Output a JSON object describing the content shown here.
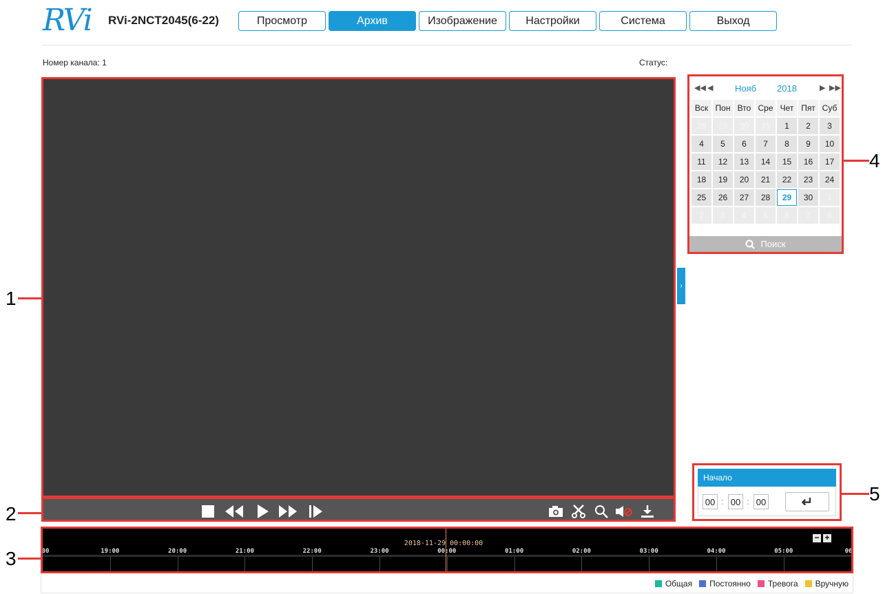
{
  "header": {
    "logo_text": "RVi",
    "model": "RVi-2NCT2045(6-22)",
    "nav": [
      {
        "label": "Просмотр",
        "active": false
      },
      {
        "label": "Архив",
        "active": true
      },
      {
        "label": "Изображение",
        "active": false
      },
      {
        "label": "Настройки",
        "active": false
      },
      {
        "label": "Система",
        "active": false
      },
      {
        "label": "Выход",
        "active": false
      }
    ]
  },
  "info": {
    "channel": "Номер канала: 1",
    "status": "Статус:"
  },
  "calendar": {
    "month": "Нояб",
    "year": "2018",
    "weekdays": [
      "Вск",
      "Пон",
      "Вто",
      "Сре",
      "Чет",
      "Пят",
      "Суб"
    ],
    "days": [
      {
        "d": "28",
        "other": true
      },
      {
        "d": "29",
        "other": true
      },
      {
        "d": "30",
        "other": true
      },
      {
        "d": "31",
        "other": true
      },
      {
        "d": "1"
      },
      {
        "d": "2"
      },
      {
        "d": "3"
      },
      {
        "d": "4"
      },
      {
        "d": "5"
      },
      {
        "d": "6"
      },
      {
        "d": "7"
      },
      {
        "d": "8"
      },
      {
        "d": "9"
      },
      {
        "d": "10"
      },
      {
        "d": "11"
      },
      {
        "d": "12"
      },
      {
        "d": "13"
      },
      {
        "d": "14"
      },
      {
        "d": "15"
      },
      {
        "d": "16"
      },
      {
        "d": "17"
      },
      {
        "d": "18"
      },
      {
        "d": "19"
      },
      {
        "d": "20"
      },
      {
        "d": "21"
      },
      {
        "d": "22"
      },
      {
        "d": "23"
      },
      {
        "d": "24"
      },
      {
        "d": "25"
      },
      {
        "d": "26"
      },
      {
        "d": "27"
      },
      {
        "d": "28"
      },
      {
        "d": "29",
        "today": true
      },
      {
        "d": "30"
      },
      {
        "d": "1",
        "other": true
      },
      {
        "d": "2",
        "other": true
      },
      {
        "d": "3",
        "other": true
      },
      {
        "d": "4",
        "other": true
      },
      {
        "d": "5",
        "other": true
      },
      {
        "d": "6",
        "other": true
      },
      {
        "d": "7",
        "other": true
      },
      {
        "d": "8",
        "other": true
      }
    ],
    "search_label": "Поиск"
  },
  "start": {
    "title": "Начало",
    "hours": "00",
    "minutes": "00",
    "seconds": "00",
    "enter_symbol": "↵"
  },
  "timeline": {
    "datetime": "2018-11-29 00:00:00",
    "ticks": [
      "00",
      "19:00",
      "20:00",
      "21:00",
      "22:00",
      "23:00",
      "00:00",
      "01:00",
      "02:00",
      "03:00",
      "04:00",
      "05:00",
      "06"
    ],
    "zoom_out": "−",
    "zoom_in": "+"
  },
  "legend": [
    {
      "label": "Общая",
      "color": "#1bb89a"
    },
    {
      "label": "Постоянно",
      "color": "#4f6fd0"
    },
    {
      "label": "Тревога",
      "color": "#f0508a"
    },
    {
      "label": "Вручную",
      "color": "#f2c12e"
    }
  ],
  "callouts": [
    "1",
    "2",
    "3",
    "4",
    "5"
  ]
}
